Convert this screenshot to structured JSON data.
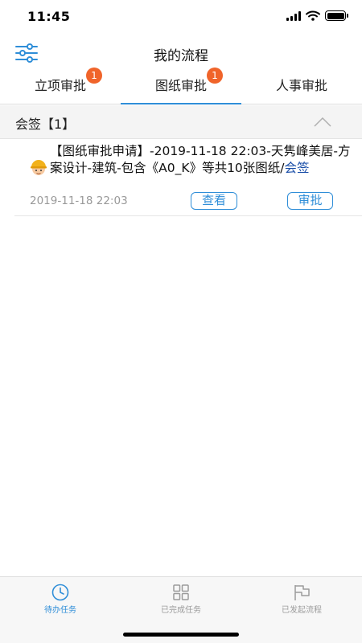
{
  "status_bar": {
    "time": "11:45"
  },
  "nav": {
    "title": "我的流程"
  },
  "tabs": [
    {
      "label": "立项审批",
      "badge": "1",
      "active": false
    },
    {
      "label": "图纸审批",
      "badge": "1",
      "active": true
    },
    {
      "label": "人事审批",
      "badge": "",
      "active": false
    }
  ],
  "section": {
    "title": "会签【1】"
  },
  "tasks": [
    {
      "text": "【图纸审批申请】-2019-11-18 22:03-天隽峰美居-方案设计-建筑-包含《A0_K》等共10张图纸/",
      "link": "会签",
      "date": "2019-11-18 22:03",
      "view_label": "查看",
      "approve_label": "审批"
    }
  ],
  "tab_bar": [
    {
      "label": "待办任务",
      "icon": "clock-icon",
      "active": true
    },
    {
      "label": "已完成任务",
      "icon": "grid-icon",
      "active": false
    },
    {
      "label": "已发起流程",
      "icon": "flag-icon",
      "active": false
    }
  ],
  "colors": {
    "accent": "#2f8ed8",
    "badge": "#f0642a",
    "link": "#1a4ea8"
  }
}
